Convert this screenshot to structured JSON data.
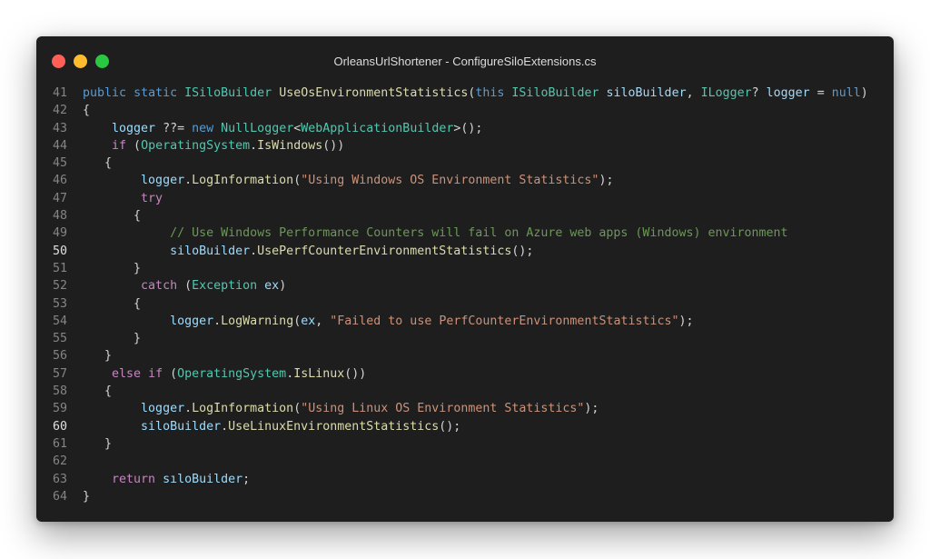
{
  "window": {
    "title": "OrleansUrlShortener - ConfigureSiloExtensions.cs",
    "buttons": [
      {
        "name": "close-button",
        "color": "#ff5f57"
      },
      {
        "name": "minimize-button",
        "color": "#febc2e"
      },
      {
        "name": "maximize-button",
        "color": "#28c840"
      }
    ]
  },
  "colors": {
    "keyword": "#569cd6",
    "control": "#c586c0",
    "type": "#4ec9b0",
    "method": "#dcdcaa",
    "variable": "#9cdcfe",
    "string": "#ce9178",
    "comment": "#6a9955",
    "plain": "#d4d4d4"
  },
  "editor": {
    "active_lines": [
      "50",
      "60"
    ],
    "lines": [
      {
        "num": "41",
        "indent": 0,
        "tokens": [
          [
            "public",
            "keyword"
          ],
          [
            " ",
            "plain"
          ],
          [
            "static",
            "keyword"
          ],
          [
            " ",
            "plain"
          ],
          [
            "ISiloBuilder",
            "type"
          ],
          [
            " ",
            "plain"
          ],
          [
            "UseOsEnvironmentStatistics",
            "method"
          ],
          [
            "(",
            "plain"
          ],
          [
            "this",
            "keyword"
          ],
          [
            " ",
            "plain"
          ],
          [
            "ISiloBuilder",
            "type"
          ],
          [
            " ",
            "plain"
          ],
          [
            "siloBuilder",
            "variable"
          ],
          [
            ", ",
            "plain"
          ],
          [
            "ILogger",
            "type"
          ],
          [
            "? ",
            "plain"
          ],
          [
            "logger",
            "variable"
          ],
          [
            " = ",
            "plain"
          ],
          [
            "null",
            "keyword"
          ],
          [
            ")",
            "plain"
          ]
        ]
      },
      {
        "num": "42",
        "indent": 0,
        "tokens": [
          [
            "{",
            "plain"
          ]
        ]
      },
      {
        "num": "43",
        "indent": 4,
        "tokens": [
          [
            "logger",
            "variable"
          ],
          [
            " ??= ",
            "plain"
          ],
          [
            "new",
            "keyword"
          ],
          [
            " ",
            "plain"
          ],
          [
            "NullLogger",
            "type"
          ],
          [
            "<",
            "plain"
          ],
          [
            "WebApplicationBuilder",
            "type"
          ],
          [
            ">();",
            "plain"
          ]
        ]
      },
      {
        "num": "44",
        "indent": 4,
        "tokens": [
          [
            "if",
            "control"
          ],
          [
            " (",
            "plain"
          ],
          [
            "OperatingSystem",
            "type"
          ],
          [
            ".",
            "plain"
          ],
          [
            "IsWindows",
            "method"
          ],
          [
            "())",
            "plain"
          ]
        ]
      },
      {
        "num": "45",
        "indent": 3,
        "tokens": [
          [
            "{",
            "plain"
          ]
        ]
      },
      {
        "num": "46",
        "indent": 8,
        "tokens": [
          [
            "logger",
            "variable"
          ],
          [
            ".",
            "plain"
          ],
          [
            "LogInformation",
            "method"
          ],
          [
            "(",
            "plain"
          ],
          [
            "\"Using Windows OS Environment Statistics\"",
            "string"
          ],
          [
            ");",
            "plain"
          ]
        ]
      },
      {
        "num": "47",
        "indent": 8,
        "tokens": [
          [
            "try",
            "control"
          ]
        ]
      },
      {
        "num": "48",
        "indent": 7,
        "tokens": [
          [
            "{",
            "plain"
          ]
        ]
      },
      {
        "num": "49",
        "indent": 12,
        "tokens": [
          [
            "// Use Windows Performance Counters will fail on Azure web apps (Windows) environment",
            "comment"
          ]
        ]
      },
      {
        "num": "50",
        "indent": 12,
        "tokens": [
          [
            "siloBuilder",
            "variable"
          ],
          [
            ".",
            "plain"
          ],
          [
            "UsePerfCounterEnvironmentStatistics",
            "method"
          ],
          [
            "();",
            "plain"
          ]
        ]
      },
      {
        "num": "51",
        "indent": 7,
        "tokens": [
          [
            "}",
            "plain"
          ]
        ]
      },
      {
        "num": "52",
        "indent": 8,
        "tokens": [
          [
            "catch",
            "control"
          ],
          [
            " (",
            "plain"
          ],
          [
            "Exception",
            "type"
          ],
          [
            " ",
            "plain"
          ],
          [
            "ex",
            "variable"
          ],
          [
            ")",
            "plain"
          ]
        ]
      },
      {
        "num": "53",
        "indent": 7,
        "tokens": [
          [
            "{",
            "plain"
          ]
        ]
      },
      {
        "num": "54",
        "indent": 12,
        "tokens": [
          [
            "logger",
            "variable"
          ],
          [
            ".",
            "plain"
          ],
          [
            "LogWarning",
            "method"
          ],
          [
            "(",
            "plain"
          ],
          [
            "ex",
            "variable"
          ],
          [
            ", ",
            "plain"
          ],
          [
            "\"Failed to use PerfCounterEnvironmentStatistics\"",
            "string"
          ],
          [
            ");",
            "plain"
          ]
        ]
      },
      {
        "num": "55",
        "indent": 7,
        "tokens": [
          [
            "}",
            "plain"
          ]
        ]
      },
      {
        "num": "56",
        "indent": 3,
        "tokens": [
          [
            "}",
            "plain"
          ]
        ]
      },
      {
        "num": "57",
        "indent": 4,
        "tokens": [
          [
            "else",
            "control"
          ],
          [
            " ",
            "plain"
          ],
          [
            "if",
            "control"
          ],
          [
            " (",
            "plain"
          ],
          [
            "OperatingSystem",
            "type"
          ],
          [
            ".",
            "plain"
          ],
          [
            "IsLinux",
            "method"
          ],
          [
            "())",
            "plain"
          ]
        ]
      },
      {
        "num": "58",
        "indent": 3,
        "tokens": [
          [
            "{",
            "plain"
          ]
        ]
      },
      {
        "num": "59",
        "indent": 8,
        "tokens": [
          [
            "logger",
            "variable"
          ],
          [
            ".",
            "plain"
          ],
          [
            "LogInformation",
            "method"
          ],
          [
            "(",
            "plain"
          ],
          [
            "\"Using Linux OS Environment Statistics\"",
            "string"
          ],
          [
            ");",
            "plain"
          ]
        ]
      },
      {
        "num": "60",
        "indent": 8,
        "tokens": [
          [
            "siloBuilder",
            "variable"
          ],
          [
            ".",
            "plain"
          ],
          [
            "UseLinuxEnvironmentStatistics",
            "method"
          ],
          [
            "();",
            "plain"
          ]
        ]
      },
      {
        "num": "61",
        "indent": 3,
        "tokens": [
          [
            "}",
            "plain"
          ]
        ]
      },
      {
        "num": "62",
        "indent": 0,
        "tokens": []
      },
      {
        "num": "63",
        "indent": 4,
        "tokens": [
          [
            "return",
            "control"
          ],
          [
            " ",
            "plain"
          ],
          [
            "sıloBuilder",
            "variable"
          ],
          [
            ";",
            "plain"
          ]
        ]
      },
      {
        "num": "64",
        "indent": 0,
        "tokens": [
          [
            "}",
            "plain"
          ]
        ]
      }
    ]
  }
}
